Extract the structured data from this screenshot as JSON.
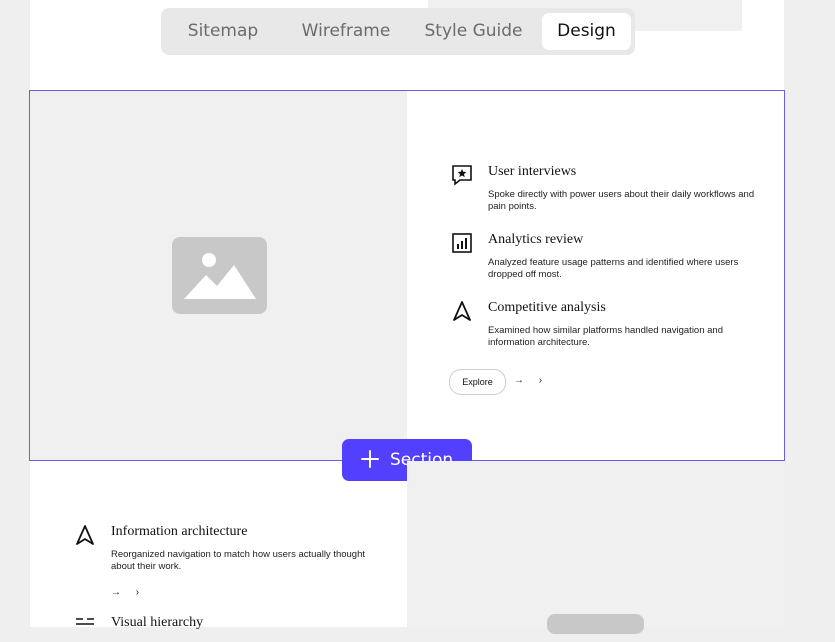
{
  "tabs": [
    {
      "label": "Sitemap",
      "active": false
    },
    {
      "label": "Wireframe",
      "active": false
    },
    {
      "label": "Style Guide",
      "active": false
    },
    {
      "label": "Design",
      "active": true
    }
  ],
  "section1": {
    "features": [
      {
        "icon": "message-star-icon",
        "title": "User interviews",
        "description": "Spoke directly with power users about their daily workflows and pain points."
      },
      {
        "icon": "bar-chart-icon",
        "title": "Analytics review",
        "description": "Analyzed feature usage patterns and identified where users dropped off most."
      },
      {
        "icon": "navigation-arrow-icon",
        "title": "Competitive analysis",
        "description": "Examined how similar platforms handled navigation and information architecture."
      }
    ],
    "explore_label": "Explore",
    "arrows": "→ ›"
  },
  "add_section_label": "Section",
  "section2": {
    "features": [
      {
        "icon": "navigation-arrow-icon",
        "title": "Information architecture",
        "description": "Reorganized navigation to match how users actually thought about their work."
      },
      {
        "icon": "layout-grid-icon",
        "title": "Visual hierarchy",
        "description": ""
      }
    ],
    "arrows": "→ ›"
  },
  "colors": {
    "accent": "#5340ff",
    "selection": "#6c5ce7"
  }
}
